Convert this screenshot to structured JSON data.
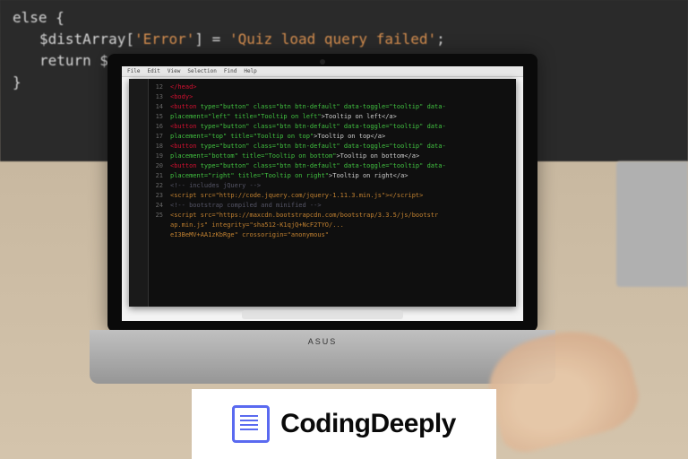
{
  "background_monitor": {
    "line1_a": "else {",
    "line2_a": "$distArray[",
    "line2_b": "'Error'",
    "line2_c": "] = ",
    "line2_d": "'Quiz load query failed'",
    "line2_e": ";",
    "line3_a": "return $distArray:",
    "line4_a": "}"
  },
  "laptop": {
    "brand": "ASUS",
    "menubar_items": [
      "File",
      "Edit",
      "View",
      "Selection",
      "Find",
      "Help"
    ],
    "editor": {
      "line_numbers": [
        "12",
        "13",
        "14",
        "15",
        "16",
        "17",
        "18",
        "19",
        "20",
        "21",
        "22",
        "23",
        "24",
        "25"
      ],
      "lines": [
        {
          "t": "tag",
          "a": "</head>"
        },
        {
          "t": "tag",
          "a": "<body>"
        },
        {
          "t": "mix",
          "tag": "<button ",
          "attr": "type=\"button\" class=\"btn btn-default\" data-toggle=\"tooltip\" data-"
        },
        {
          "t": "mix",
          "tag": "",
          "attr": "placement=\"left\" title=\"Tooltip on left\"",
          "end": ">Tooltip on left</a>"
        },
        {
          "t": "mix",
          "tag": "<button ",
          "attr": "type=\"button\" class=\"btn btn-default\" data-toggle=\"tooltip\" data-"
        },
        {
          "t": "mix",
          "tag": "",
          "attr": "placement=\"top\" title=\"Tooltip on top\"",
          "end": ">Tooltip on top</a>"
        },
        {
          "t": "mix",
          "tag": "<button ",
          "attr": "type=\"button\" class=\"btn btn-default\" data-toggle=\"tooltip\" data-"
        },
        {
          "t": "mix",
          "tag": "",
          "attr": "placement=\"bottom\" title=\"Tooltip on bottom\"",
          "end": ">Tooltip on bottom</a>"
        },
        {
          "t": "mix",
          "tag": "<button ",
          "attr": "type=\"button\" class=\"btn btn-default\" data-toggle=\"tooltip\" data-"
        },
        {
          "t": "mix",
          "tag": "",
          "attr": "placement=\"right\" title=\"Tooltip on right\"",
          "end": ">Tooltip on right</a>"
        },
        {
          "t": "com",
          "a": "<!-- includes jQuery -->"
        },
        {
          "t": "scr",
          "a": "<script src=\"http://code.jquery.com/jquery-1.11.3.min.js\"></script>"
        },
        {
          "t": "com",
          "a": "<!-- bootstrap compiled and minified -->"
        },
        {
          "t": "scr",
          "a": "<script src=\"https://maxcdn.bootstrapcdn.com/bootstrap/3.3.5/js/bootstr"
        }
      ],
      "trail1": "ap.min.js\" integrity=\"sha512-K1qjQ+NcF2TYO/...",
      "trail2": "eI3BeMV+AA1zKbRge\" crossorigin=\"anonymous\""
    }
  },
  "watermark": {
    "text": "CodingDeeply"
  }
}
